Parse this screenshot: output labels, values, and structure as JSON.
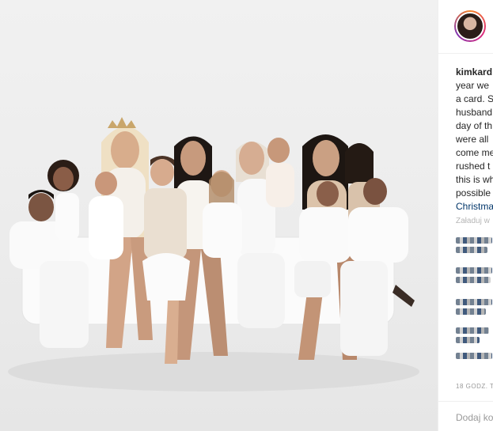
{
  "post": {
    "username": "kimkard",
    "caption_lines": [
      "year we",
      "a card. S",
      "husband",
      "day of th",
      "were all",
      "come me",
      "rushed t",
      "this is wh",
      "possible",
      "Christma"
    ],
    "reply_label": "Załaduj w",
    "timestamp": "18 GODZ. T",
    "add_comment_placeholder": "Dodaj ko"
  },
  "colors": {
    "avatar_ring": "#dd2a7b",
    "text": "#262626",
    "muted": "#999999",
    "link": "#003569"
  },
  "photo": {
    "subject": "family-holiday-photo-on-white-sofa",
    "people_count": 13
  }
}
